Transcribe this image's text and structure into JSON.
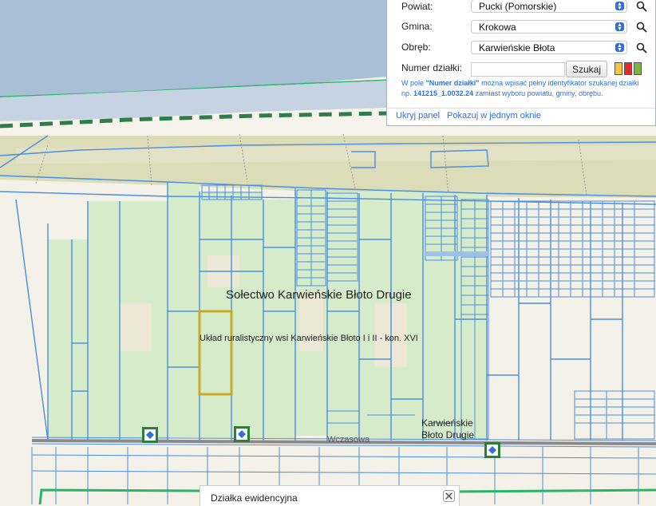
{
  "panel": {
    "powiat_label": "Powiat:",
    "powiat_value": "Pucki (Pomorskie)",
    "gmina_label": "Gmina:",
    "gmina_value": "Krokowa",
    "obreb_label": "Obręb:",
    "obreb_value": "Karwieńskie Błota",
    "numer_label": "Numer działki:",
    "numer_value": "",
    "search_button": "Szukaj",
    "color_swatches": [
      "#f5c542",
      "#e02b2b",
      "#7cb342"
    ],
    "hint_line1_prefix": "W pole ",
    "hint_line1_bold": "\"Numer działki\"",
    "hint_line1_suffix": " można wpisać pełny identyfikator szukanej działki",
    "hint_line2_prefix": "np. ",
    "hint_line2_bold": "141215_1.0032.24",
    "hint_line2_suffix": " zamiast wyboru powiatu, gminy, obrębu.",
    "hide_panel_link": "Ukryj panel",
    "single_window_link": "Pokazuj w jednym oknie"
  },
  "map": {
    "label_solectwo": "Sołectwo Karwieńskie Błoto Drugie",
    "label_uklad": "Układ ruralistyczny wsi  Karwieńskie Błoto I i II - kon. XVI",
    "label_village_line1": "Karwieńskie",
    "label_village_line2": "Błoto Drugie",
    "label_street": "Wczasowa",
    "colors": {
      "sea": "#a9bfd6",
      "land": "#f4f1e8",
      "sand": "#f7f3ea",
      "grass": "#d6ebc9",
      "scrub": "#dcdcb8",
      "parcel_line": "#4a8fe0",
      "boundary_green": "#2cb36b",
      "highlight": "#c9a82a"
    }
  },
  "bottom_tab": {
    "title": "Działka ewidencyjna"
  },
  "icons": [
    "search-icon",
    "close-icon",
    "poi-marker-icon"
  ]
}
